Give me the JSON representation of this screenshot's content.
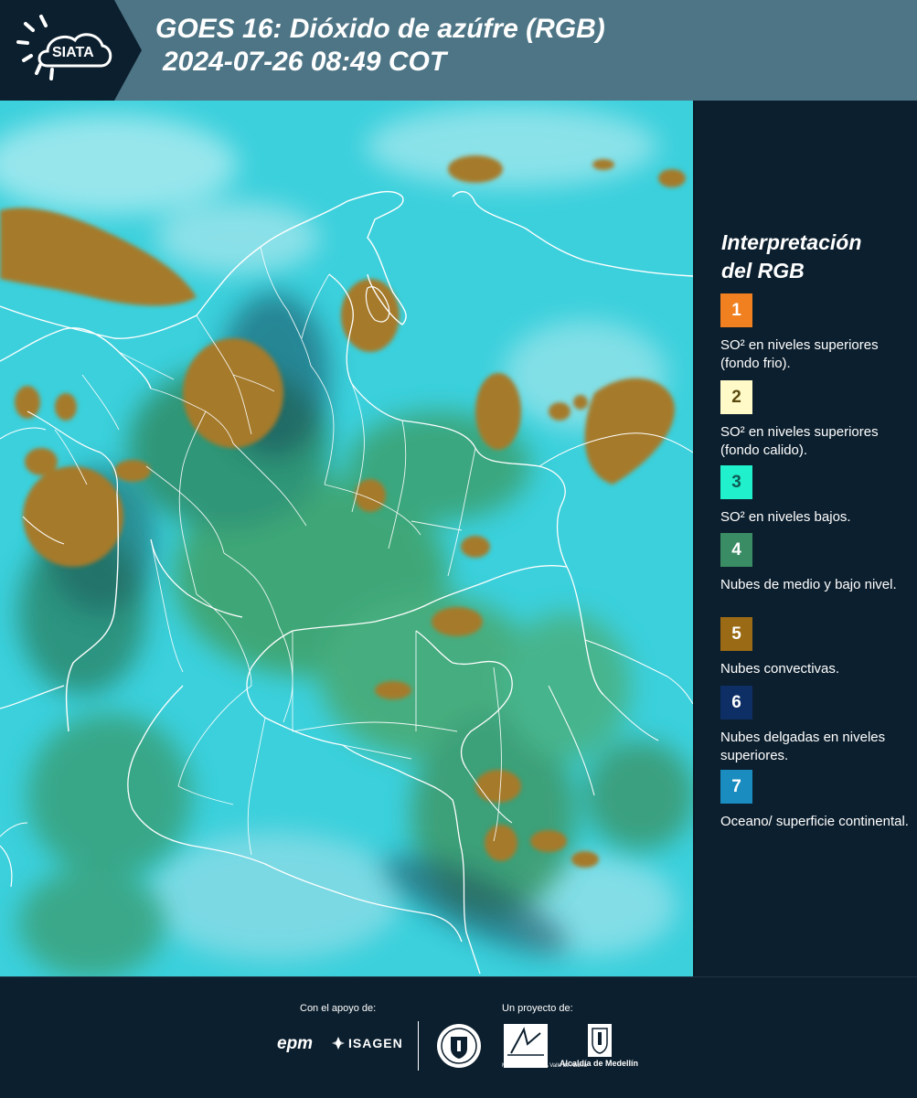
{
  "header": {
    "logo_text": "SIATA",
    "title_line1": "GOES 16: Dióxido de azúfre (RGB)",
    "title_line2": "2024-07-26 08:49 COT"
  },
  "legend": {
    "title_line1": "Interpretación",
    "title_line2": "del RGB",
    "items": [
      {
        "number": "1",
        "color": "#f08020",
        "text": "SO² en niveles superiores (fondo frio)."
      },
      {
        "number": "2",
        "color": "#fffac8",
        "text": "SO² en niveles superiores (fondo calido)."
      },
      {
        "number": "3",
        "color": "#20f0cc",
        "text": "SO² en niveles bajos."
      },
      {
        "number": "4",
        "color": "#3a8c64",
        "text": "Nubes de medio y bajo nivel."
      },
      {
        "number": "5",
        "color": "#9a6a14",
        "text": "Nubes convectivas."
      },
      {
        "number": "6",
        "color": "#0e2f66",
        "text": "Nubes delgadas en niveles superiores."
      },
      {
        "number": "7",
        "color": "#1a8cc0",
        "text": "Oceano/ superficie continental."
      }
    ]
  },
  "footer": {
    "support_label": "Con el apoyo de:",
    "project_label": "Un proyecto de:",
    "sponsor1": "epm",
    "sponsor2": "ISAGEN",
    "partner_area": "METROPOLITANA Valle de Aburrá",
    "partner_alcaldia": "Alcaldía de Medellín"
  },
  "map": {
    "background_color": "#3bd0dc",
    "convective_color": "#a57a2c",
    "boundary_color": "#ffffff"
  }
}
